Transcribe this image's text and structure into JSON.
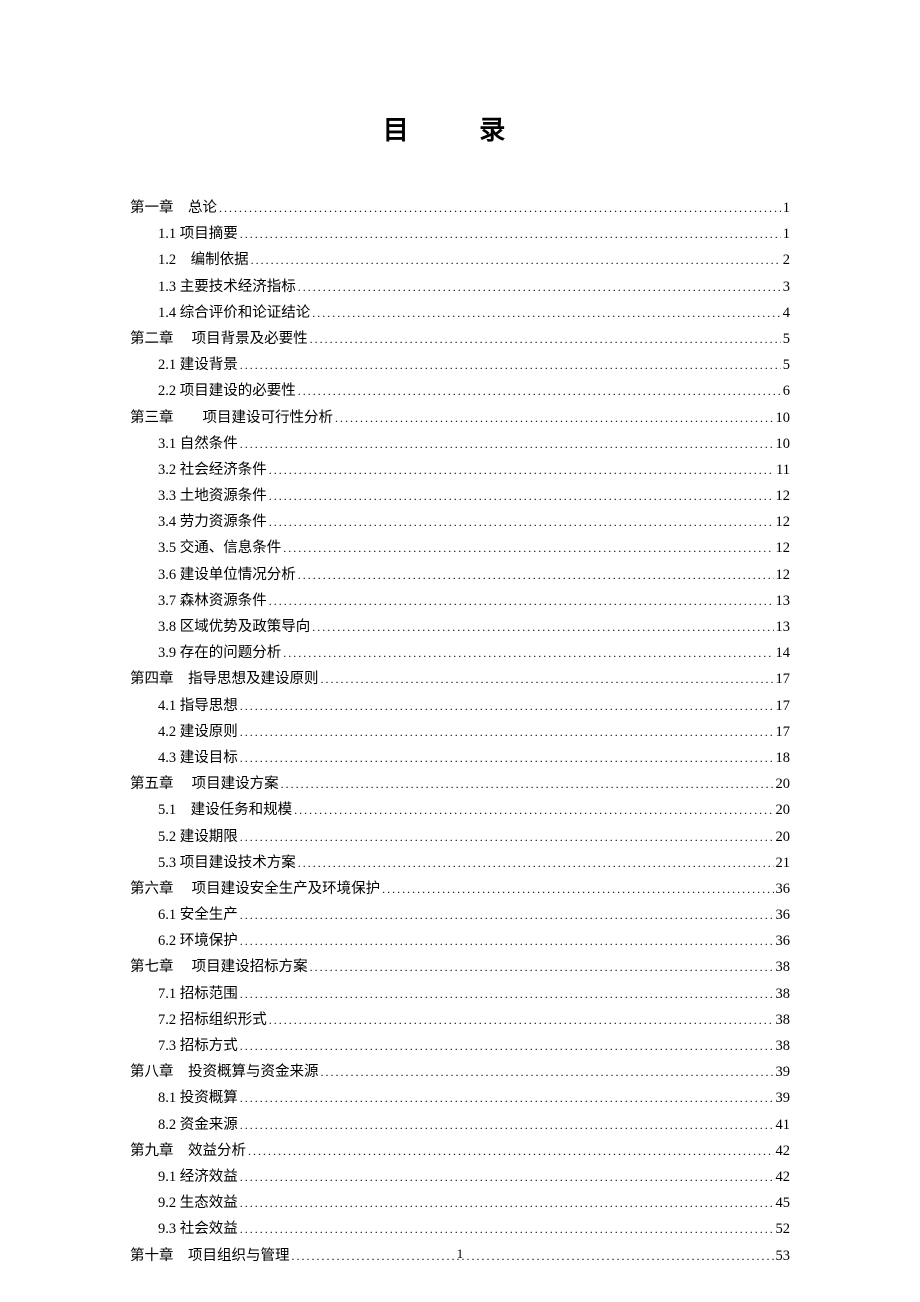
{
  "title": "目 录",
  "page_number": "1",
  "toc": [
    {
      "level": 1,
      "label": "第一章　总论",
      "page": "1"
    },
    {
      "level": 2,
      "label": "1.1 项目摘要",
      "page": "1"
    },
    {
      "level": 2,
      "label": "1.2　编制依据",
      "page": "2"
    },
    {
      "level": 2,
      "label": "1.3 主要技术经济指标",
      "page": "3"
    },
    {
      "level": 2,
      "label": "1.4 综合评价和论证结论",
      "page": "4"
    },
    {
      "level": 1,
      "label": "第二章　 项目背景及必要性",
      "page": "5"
    },
    {
      "level": 2,
      "label": "2.1 建设背景",
      "page": "5"
    },
    {
      "level": 2,
      "label": "2.2 项目建设的必要性",
      "page": "6"
    },
    {
      "level": 1,
      "label": "第三章　　项目建设可行性分析",
      "page": "10"
    },
    {
      "level": 2,
      "label": "3.1 自然条件",
      "page": "10"
    },
    {
      "level": 2,
      "label": "3.2 社会经济条件",
      "page": "11"
    },
    {
      "level": 2,
      "label": "3.3 土地资源条件",
      "page": "12"
    },
    {
      "level": 2,
      "label": "3.4 劳力资源条件",
      "page": "12"
    },
    {
      "level": 2,
      "label": "3.5 交通、信息条件",
      "page": "12"
    },
    {
      "level": 2,
      "label": "3.6 建设单位情况分析",
      "page": "12"
    },
    {
      "level": 2,
      "label": "3.7 森林资源条件",
      "page": "13"
    },
    {
      "level": 2,
      "label": "3.8 区域优势及政策导向",
      "page": "13"
    },
    {
      "level": 2,
      "label": "3.9 存在的问题分析",
      "page": "14"
    },
    {
      "level": 1,
      "label": "第四章　指导思想及建设原则",
      "page": "17"
    },
    {
      "level": 2,
      "label": "4.1 指导思想",
      "page": "17"
    },
    {
      "level": 2,
      "label": "4.2 建设原则",
      "page": "17"
    },
    {
      "level": 2,
      "label": "4.3 建设目标",
      "page": "18"
    },
    {
      "level": 1,
      "label": "第五章　 项目建设方案",
      "page": "20"
    },
    {
      "level": 2,
      "label": "5.1　建设任务和规模",
      "page": "20"
    },
    {
      "level": 2,
      "label": "5.2 建设期限",
      "page": "20"
    },
    {
      "level": 2,
      "label": "5.3 项目建设技术方案",
      "page": "21"
    },
    {
      "level": 1,
      "label": "第六章　 项目建设安全生产及环境保护",
      "page": "36"
    },
    {
      "level": 2,
      "label": "6.1 安全生产",
      "page": "36"
    },
    {
      "level": 2,
      "label": "6.2 环境保护",
      "page": "36"
    },
    {
      "level": 1,
      "label": "第七章　 项目建设招标方案",
      "page": "38"
    },
    {
      "level": 2,
      "label": "7.1 招标范围",
      "page": "38"
    },
    {
      "level": 2,
      "label": "7.2 招标组织形式",
      "page": "38"
    },
    {
      "level": 2,
      "label": "7.3 招标方式",
      "page": "38"
    },
    {
      "level": 1,
      "label": "第八章　投资概算与资金来源",
      "page": "39"
    },
    {
      "level": 2,
      "label": "8.1 投资概算",
      "page": "39"
    },
    {
      "level": 2,
      "label": "8.2 资金来源",
      "page": "41"
    },
    {
      "level": 1,
      "label": "第九章　效益分析",
      "page": "42"
    },
    {
      "level": 2,
      "label": "9.1 经济效益",
      "page": "42"
    },
    {
      "level": 2,
      "label": "9.2 生态效益",
      "page": "45"
    },
    {
      "level": 2,
      "label": "9.3 社会效益",
      "page": "52"
    },
    {
      "level": 1,
      "label": "第十章　项目组织与管理",
      "page": "53"
    }
  ]
}
